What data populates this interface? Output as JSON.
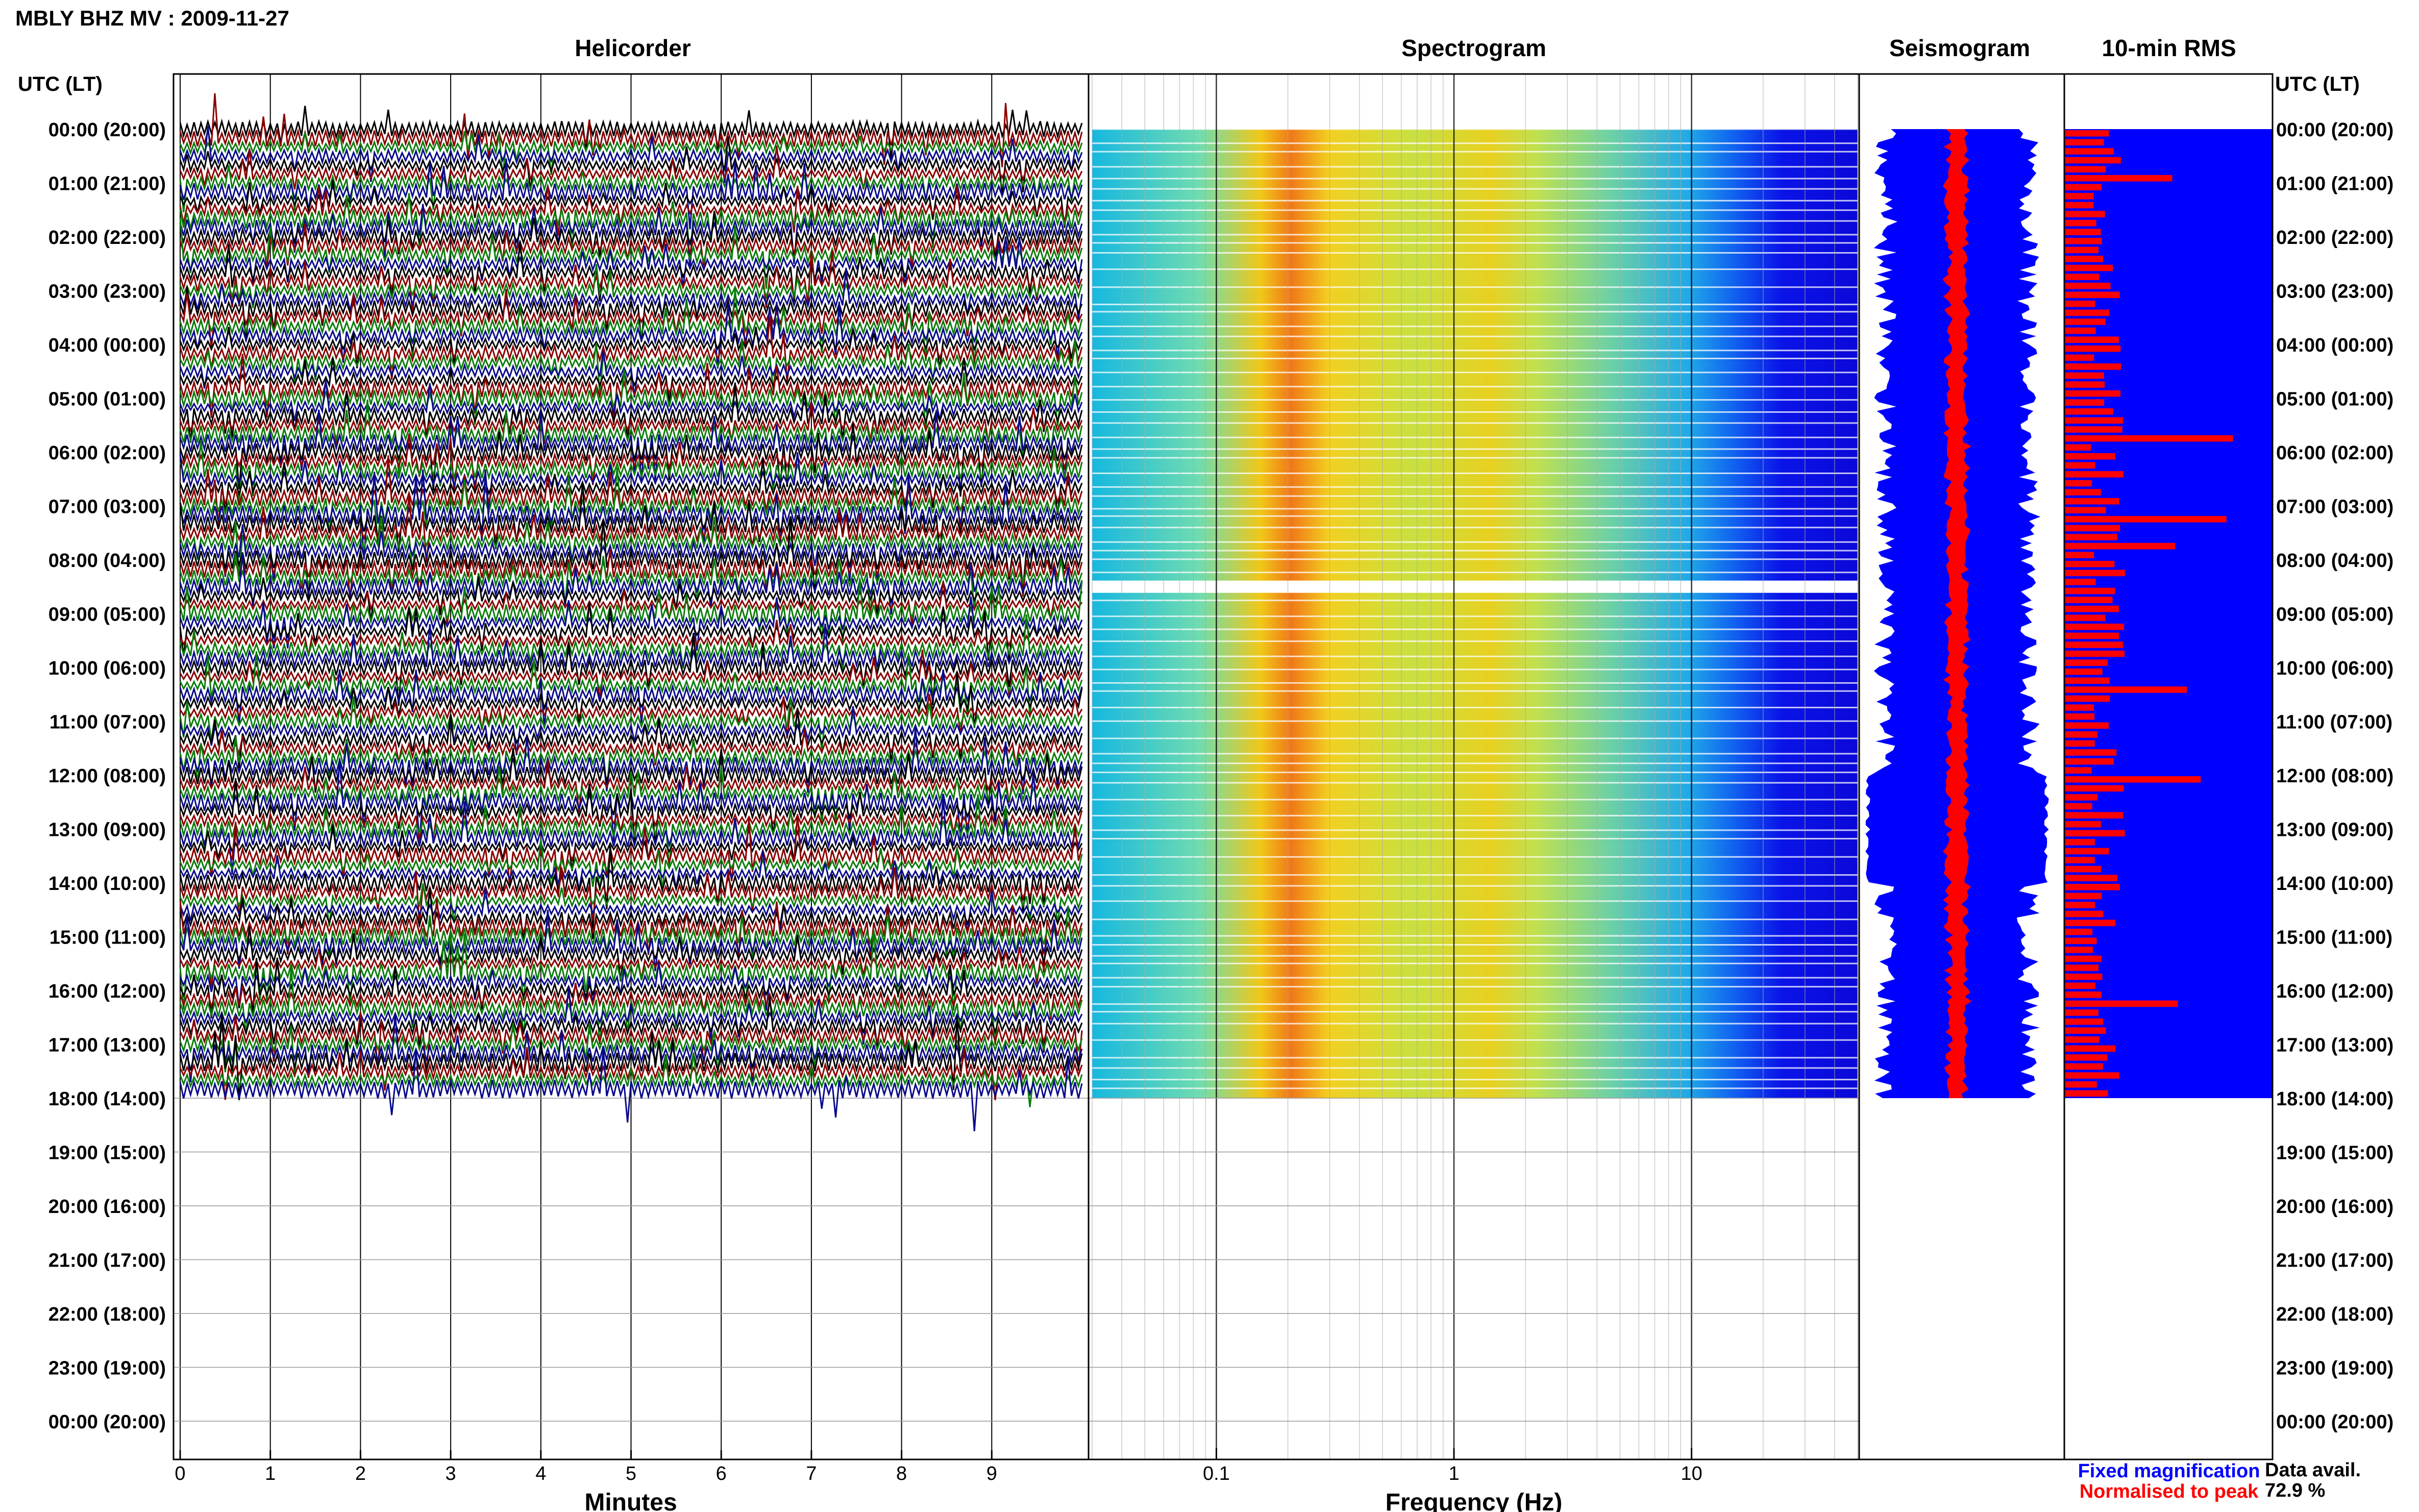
{
  "header": {
    "station_title": "MBLY BHZ MV : 2009-11-27",
    "panel_titles": {
      "helicorder": "Helicorder",
      "spectrogram": "Spectrogram",
      "seismogram": "Seismogram",
      "rms": "10-min RMS"
    },
    "time_axis_label_left": "UTC (LT)",
    "time_axis_label_right": "UTC (LT)"
  },
  "legend": {
    "fixed": "Fixed magnification",
    "normalised": "Normalised to peak",
    "data_avail_label": "Data avail.",
    "data_avail_value": "72.9 %"
  },
  "colors": {
    "trace_cycle": [
      "#000000",
      "#8b0000",
      "#0a7d0a",
      "#0a0a8c"
    ],
    "fixed": "#0000ff",
    "normalised": "#ff0000",
    "rms_background": "#0000ff",
    "rms_bars": "#ff0000"
  },
  "chart_data": [
    {
      "type": "line",
      "name": "helicorder",
      "title": "Helicorder",
      "xlabel": "Minutes",
      "x_ticks": [
        "0",
        "1",
        "2",
        "3",
        "4",
        "5",
        "6",
        "7",
        "8",
        "9"
      ],
      "xlim": [
        0,
        10
      ],
      "y_tick_labels": [
        "00:00 (20:00)",
        "01:00 (21:00)",
        "02:00 (22:00)",
        "03:00 (23:00)",
        "04:00 (00:00)",
        "05:00 (01:00)",
        "06:00 (02:00)",
        "07:00 (03:00)",
        "08:00 (04:00)",
        "09:00 (05:00)",
        "10:00 (06:00)",
        "11:00 (07:00)",
        "12:00 (08:00)",
        "13:00 (09:00)",
        "14:00 (10:00)",
        "15:00 (11:00)",
        "16:00 (12:00)",
        "17:00 (13:00)",
        "18:00 (14:00)",
        "19:00 (15:00)",
        "20:00 (16:00)",
        "21:00 (17:00)",
        "22:00 (18:00)",
        "23:00 (19:00)",
        "00:00 (20:00)"
      ],
      "lines_per_hour": 6,
      "data_end_hour": 18
    },
    {
      "type": "heatmap",
      "name": "spectrogram",
      "title": "Spectrogram",
      "xlabel": "Frequency (Hz)",
      "x_scale": "log",
      "x_tick_labels": [
        "0.1",
        "1",
        "10"
      ],
      "xlim_hz": [
        0.03,
        50
      ],
      "data_end_hour": 18,
      "gap_hour": 8.5
    },
    {
      "type": "area",
      "name": "seismogram",
      "title": "Seismogram",
      "series": [
        "Fixed magnification",
        "Normalised to peak"
      ],
      "data_end_hour": 18
    },
    {
      "type": "bar",
      "name": "rms",
      "title": "10-min RMS",
      "orientation": "horizontal",
      "data_end_hour": 18
    }
  ]
}
